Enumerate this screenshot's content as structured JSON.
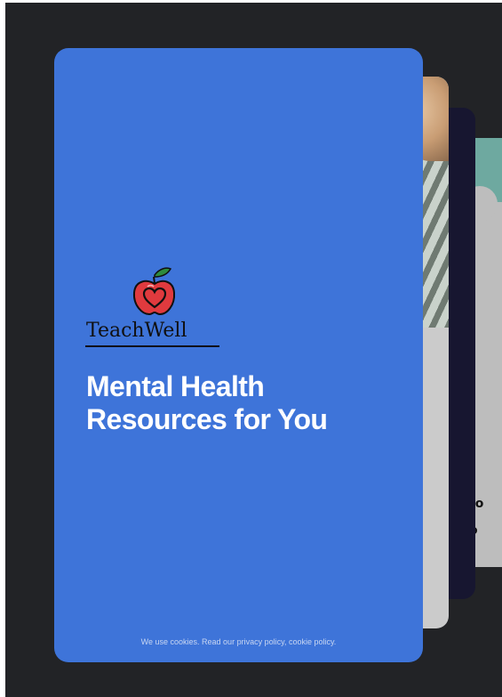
{
  "brand": {
    "name": "TeachWell",
    "colors": {
      "front_card": "#3e74d9",
      "background": "#222326",
      "apple_red": "#e03a3e",
      "leaf_green": "#2e8b3e"
    }
  },
  "hero": {
    "line1": "Mental Health",
    "line2": "Resources for You"
  },
  "footer": {
    "prefix": "We use cookies. Read our ",
    "privacy_link": "privacy policy",
    "separator": ", ",
    "cookie_link": "cookie policy",
    "suffix": "."
  },
  "back_cards": {
    "card3_text": "to\nt\no"
  },
  "icons": {
    "logo": "apple-heart-icon"
  }
}
